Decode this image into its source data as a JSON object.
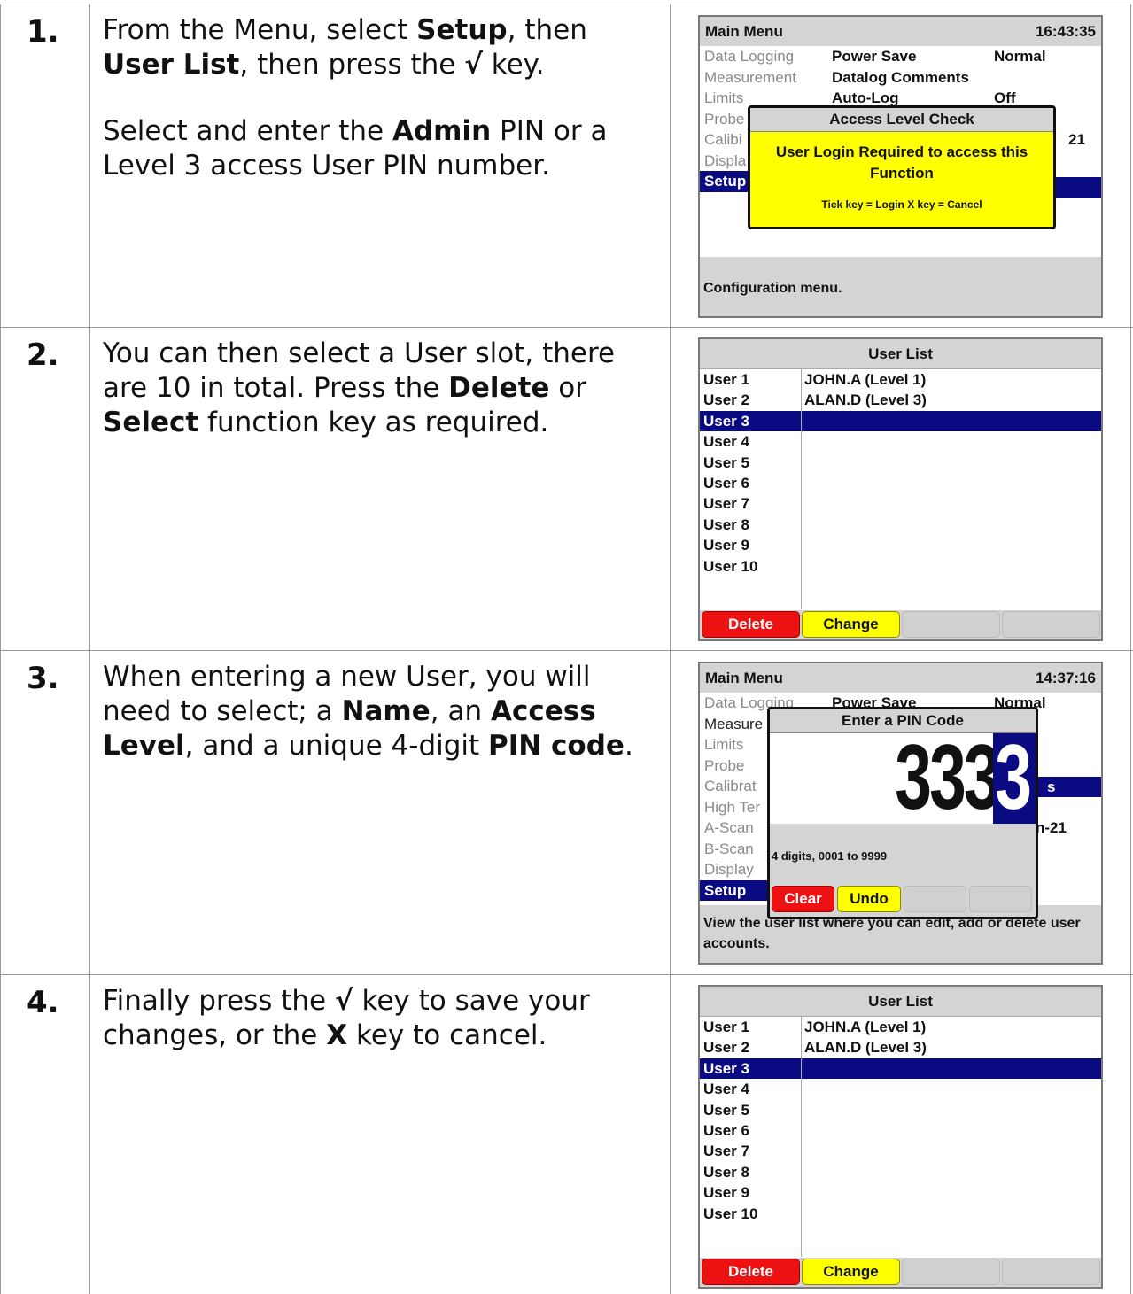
{
  "steps": [
    {
      "number": "1.",
      "paragraphs": [
        [
          "From the Menu, select ",
          {
            "b": "Setup"
          },
          ", then ",
          {
            "b": "User List"
          },
          ", then press the ",
          {
            "b": "√"
          },
          " key."
        ],
        [
          "Select and enter the ",
          {
            "b": "Admin"
          },
          " PIN or a Level 3 access User PIN number."
        ]
      ]
    },
    {
      "number": "2.",
      "paragraphs": [
        [
          "You can then select a User slot, there are 10 in total. Press the ",
          {
            "b": "Delete"
          },
          " or ",
          {
            "b": "Select"
          },
          " function key as required."
        ]
      ]
    },
    {
      "number": "3.",
      "paragraphs": [
        [
          "When entering a new User, you will need to select; a ",
          {
            "b": "Name"
          },
          ", an ",
          {
            "b": "Access Level"
          },
          ", and a unique 4-digit ",
          {
            "b": "PIN code"
          },
          "."
        ]
      ]
    },
    {
      "number": "4.",
      "paragraphs": [
        [
          "Finally press the ",
          {
            "b": "√"
          },
          " key to save your changes, or the ",
          {
            "b": "X"
          },
          " key to cancel."
        ]
      ]
    }
  ],
  "screen1": {
    "title": "Main Menu",
    "time": "16:43:35",
    "menu": [
      "Data Logging",
      "Measurement",
      "Limits",
      "Probe",
      "Calibi",
      "Displa",
      "Setup"
    ],
    "selected_menu_index": 6,
    "settings": [
      {
        "key": "Power Save",
        "value": "Normal"
      },
      {
        "key": "Datalog Comments",
        "value": ""
      },
      {
        "key": "Auto-Log",
        "value": "Off"
      }
    ],
    "partial_value": "21",
    "dialog": {
      "title": "Access Level Check",
      "message": "User Login Required to access this Function",
      "hint": "Tick key = Login  X key = Cancel"
    },
    "description": "Configuration menu."
  },
  "user_list": {
    "title": "User List",
    "users": [
      {
        "slot": "User 1",
        "name": "JOHN.A (Level 1)"
      },
      {
        "slot": "User 2",
        "name": "ALAN.D (Level 3)"
      },
      {
        "slot": "User 3",
        "name": ""
      },
      {
        "slot": "User 4",
        "name": ""
      },
      {
        "slot": "User 5",
        "name": ""
      },
      {
        "slot": "User 6",
        "name": ""
      },
      {
        "slot": "User 7",
        "name": ""
      },
      {
        "slot": "User 8",
        "name": ""
      },
      {
        "slot": "User 9",
        "name": ""
      },
      {
        "slot": "User 10",
        "name": ""
      }
    ],
    "selected_index": 2,
    "fkeys": [
      "Delete",
      "Change",
      "",
      ""
    ]
  },
  "screen3": {
    "title": "Main Menu",
    "time": "14:37:16",
    "menu": [
      "Data Logging",
      "Measure",
      "Limits",
      "Probe",
      "Calibrat",
      "High Ter",
      "A-Scan",
      "B-Scan",
      "Display",
      "Setup"
    ],
    "selected_menu_index": 9,
    "settings_partial": [
      "Power Save",
      "Normal",
      "s",
      "n-21"
    ],
    "dialog": {
      "title": "Enter a PIN Code",
      "digits": "3333",
      "hint": "4 digits, 0001 to 9999",
      "fkeys": [
        "Clear",
        "Undo",
        "",
        ""
      ]
    },
    "description": "View the user list where you can edit, add or delete user accounts."
  },
  "colors": {
    "selection": "#0a0a82",
    "dialog_yellow": "#ffff00",
    "key_red": "#ee1111",
    "key_yellow": "#ffff00",
    "panel_grey": "#d4d4d4"
  }
}
